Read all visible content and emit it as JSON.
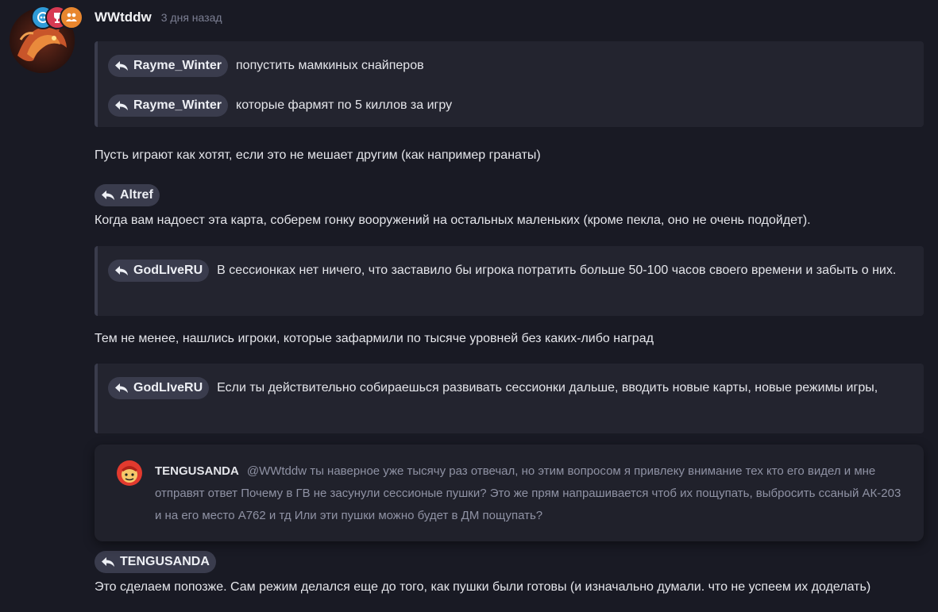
{
  "post": {
    "username": "WWtddw",
    "time": "3 дня назад",
    "badges": [
      {
        "icon": "discord-icon",
        "color": "#2f9bd8"
      },
      {
        "icon": "trophy-icon",
        "color": "#d83a53"
      },
      {
        "icon": "group-icon",
        "color": "#e8862e"
      }
    ]
  },
  "blocks": {
    "quote1": {
      "lines": [
        {
          "mention": "Rayme_Winter",
          "text": "попустить мамкиных снайперов"
        },
        {
          "mention": "Rayme_Winter",
          "text": "которые фармят по 5 киллов за игру"
        }
      ]
    },
    "para1": "Пусть играют как хотят, если это не мешает другим (как например гранаты)",
    "mention_altref": "Altref",
    "para2": "Когда вам надоест эта карта, соберем гонку вооружений на остальных маленьких (кроме пекла, оно не очень подойдет).",
    "quote2": {
      "mention": "GodLIveRU",
      "text": "В сессионках нет ничего, что заставило бы игрока потратить больше 50-100 часов своего времени и забыть о них."
    },
    "para3": "Тем не менее, нашлись игроки, которые зафармили по тысяче уровней без каких-либо наград",
    "quote3": {
      "mention": "GodLIveRU",
      "text": "Если ты действительно собираешься развивать сессионки дальше, вводить новые карты, новые режимы игры,"
    },
    "embed": {
      "author": "TENGUSANDA",
      "text": "@WWtddw ты наверное уже тысячу раз отвечал, но этим вопросом я привлеку внимание тех кто его видел и мне отправят ответ Почему в ГВ не засунули сессионые пушки? Это же прям напрашивается чтоб их пощупать, выбросить ссаный АК-203 и на его место А762 и тд Или эти пушки можно будет в ДМ пощупать?"
    },
    "mention_tengu": "TENGUSANDA",
    "para4": "Это сделаем попозже. Сам режим делался еще до того, как пушки были готовы (и изначально думали. что не успеем их доделать)"
  },
  "colors": {
    "background": "#191a24",
    "quote_bg": "#23242f",
    "mention_bg": "#3a3c4d",
    "muted_text": "#7c7f93"
  }
}
